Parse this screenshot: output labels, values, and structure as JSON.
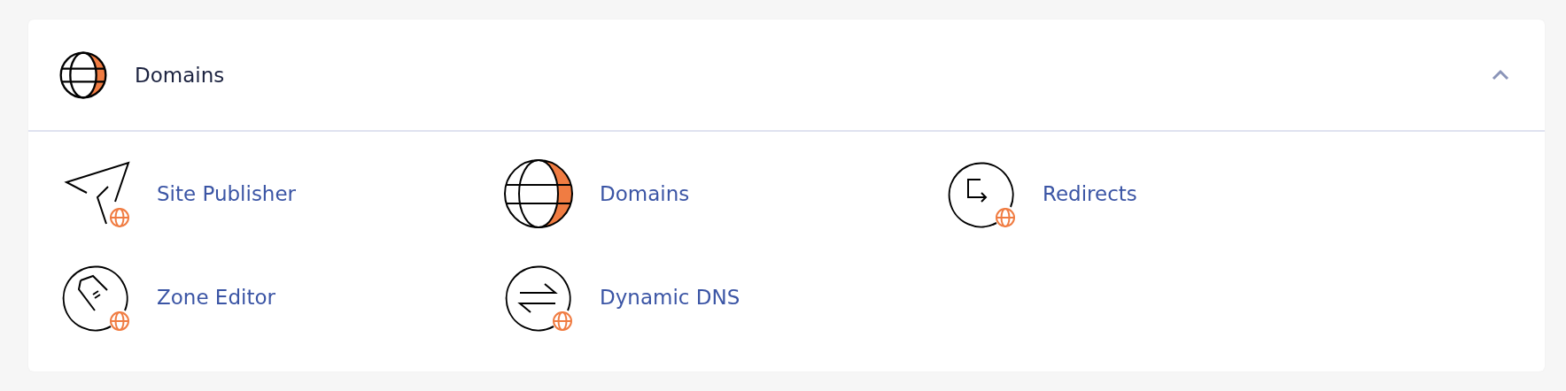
{
  "section": {
    "title": "Domains",
    "expanded": true
  },
  "items": [
    {
      "label": "Site Publisher"
    },
    {
      "label": "Domains"
    },
    {
      "label": "Redirects"
    },
    {
      "label": "Zone Editor"
    },
    {
      "label": "Dynamic DNS"
    }
  ]
}
